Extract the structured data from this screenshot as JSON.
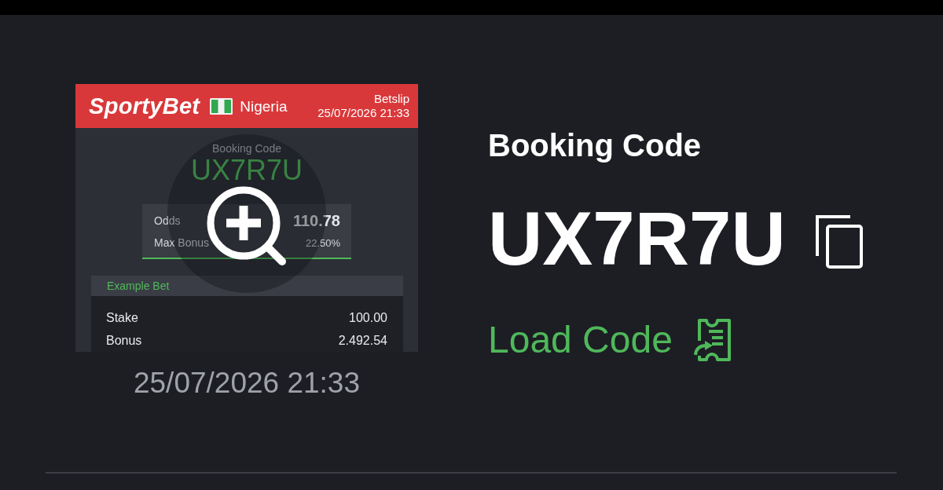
{
  "preview": {
    "header": {
      "logo": "SportyBet",
      "country": "Nigeria",
      "title": "Betslip",
      "datetime": "25/07/2026 21:33"
    },
    "booking_label": "Booking Code",
    "booking_code": "UX7R7U",
    "stats": [
      {
        "label": "Odds",
        "value": "110.78"
      },
      {
        "label": "Max Bonus",
        "value": "22.50%"
      }
    ],
    "example_bet": {
      "title": "Example Bet",
      "rows": [
        {
          "label": "Stake",
          "value": "100.00"
        },
        {
          "label": "Bonus",
          "value": "2.492.54"
        }
      ]
    }
  },
  "preview_date": "25/07/2026 21:33",
  "booking": {
    "title": "Booking Code",
    "code": "UX7R7U",
    "load_label": "Load Code"
  }
}
